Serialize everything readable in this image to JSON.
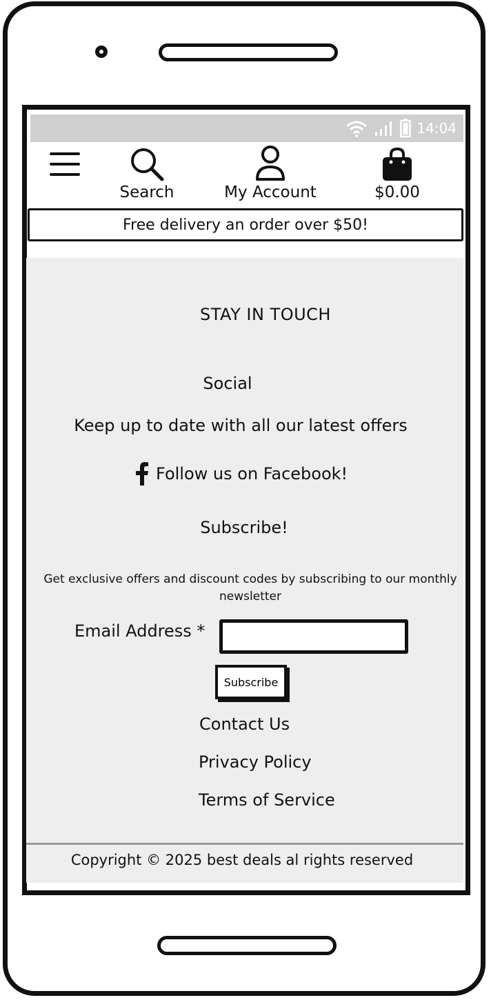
{
  "status_bar": {
    "time": "14:04"
  },
  "header": {
    "search_label": "Search",
    "account_label": "My Account",
    "cart_total": "$0.00",
    "icons": [
      "menu-icon",
      "search-icon",
      "account-icon",
      "bag-icon"
    ]
  },
  "banner": {
    "text": "Free delivery an order over $50!"
  },
  "footer": {
    "heading": "STAY IN TOUCH",
    "social_title": "Social",
    "social_text": "Keep up to date with all our latest offers",
    "facebook_link": "Follow us on Facebook!",
    "subscribe_title": "Subscribe!",
    "subscribe_text": "Get exclusive offers and discount codes by subscribing to our monthly newsletter",
    "email_label": "Email Address *",
    "email_value": "",
    "subscribe_button": "Subscribe",
    "links": [
      "Contact Us",
      "Privacy Policy",
      "Terms of Service"
    ],
    "copyright": "Copyright © 2025 best deals al rights reserved"
  },
  "colors": {
    "status_bar": "#cfcfcf",
    "footer_bg": "#eeeeee",
    "ink": "#111111"
  }
}
